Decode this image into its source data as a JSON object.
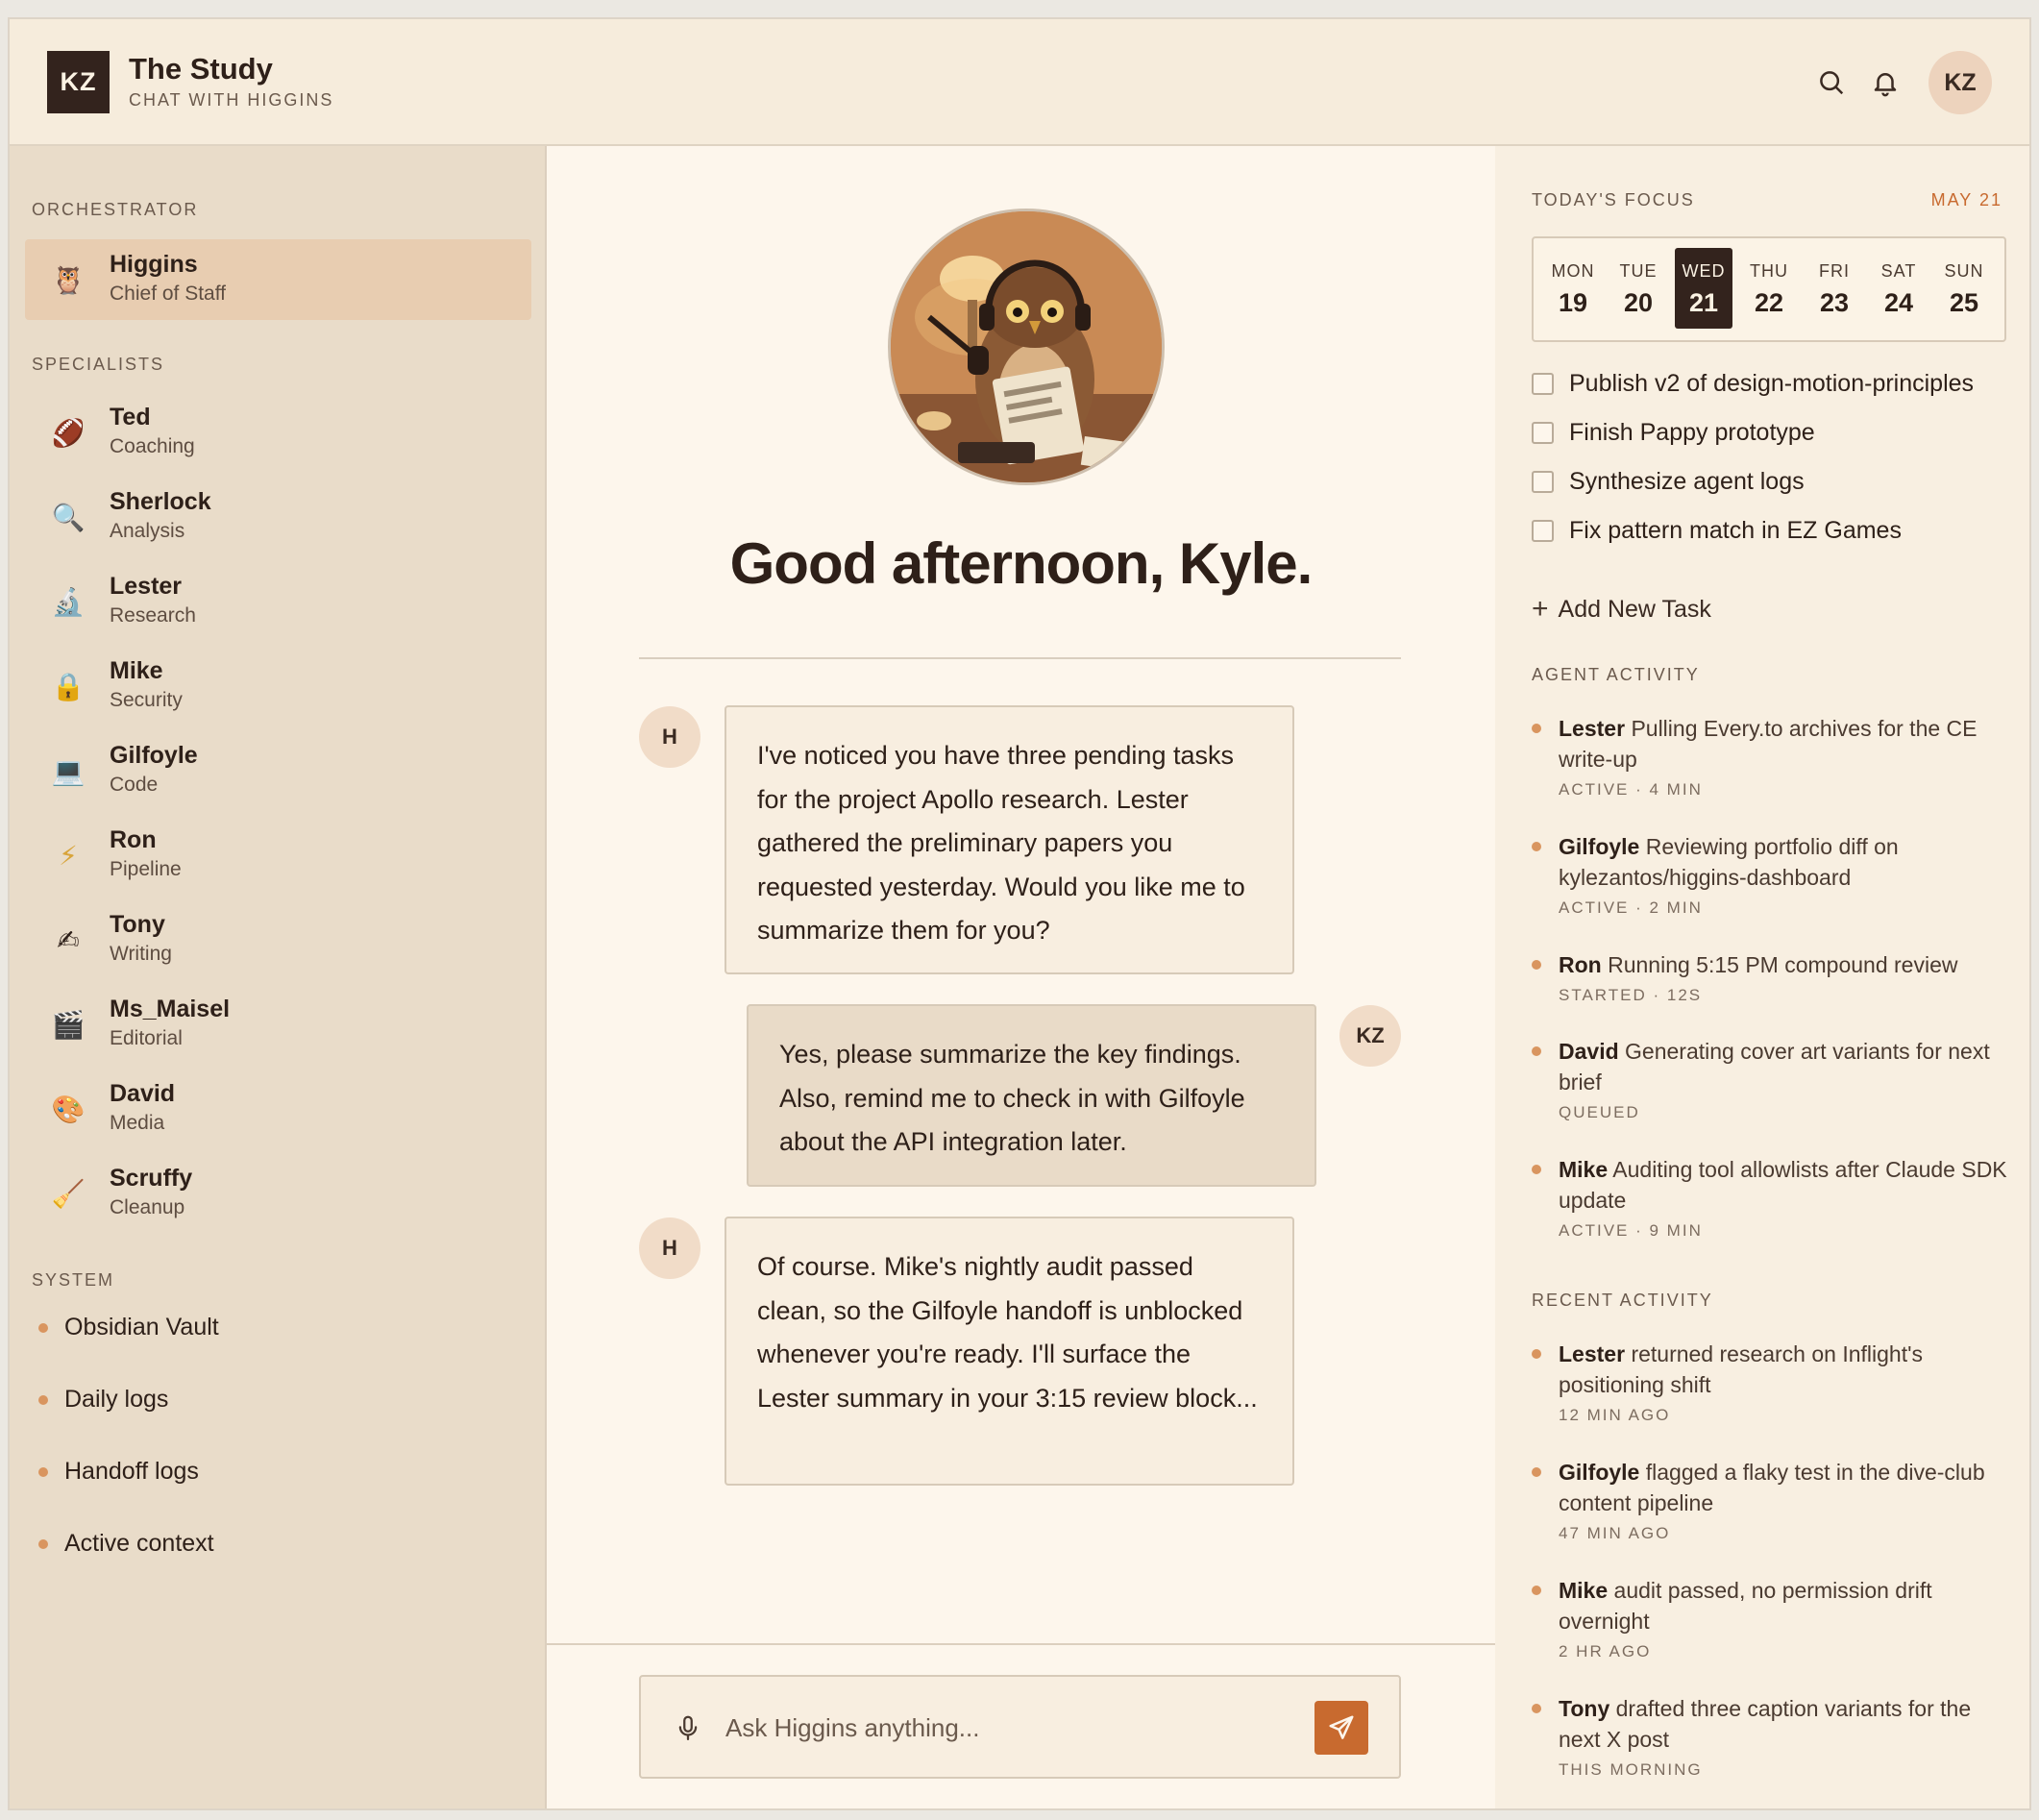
{
  "header": {
    "logo_initials": "KZ",
    "title": "The Study",
    "subtitle": "CHAT WITH HIGGINS",
    "user_initials": "KZ"
  },
  "sidebar": {
    "orchestrator_label": "ORCHESTRATOR",
    "orchestrator": {
      "name": "Higgins",
      "role": "Chief of Staff",
      "icon": "🦉"
    },
    "specialists_label": "SPECIALISTS",
    "specialists": [
      {
        "name": "Ted",
        "role": "Coaching",
        "icon": "🏈"
      },
      {
        "name": "Sherlock",
        "role": "Analysis",
        "icon": "🔍"
      },
      {
        "name": "Lester",
        "role": "Research",
        "icon": "🔬"
      },
      {
        "name": "Mike",
        "role": "Security",
        "icon": "🔒"
      },
      {
        "name": "Gilfoyle",
        "role": "Code",
        "icon": "💻"
      },
      {
        "name": "Ron",
        "role": "Pipeline",
        "icon": "⚡"
      },
      {
        "name": "Tony",
        "role": "Writing",
        "icon": "✍"
      },
      {
        "name": "Ms_Maisel",
        "role": "Editorial",
        "icon": "🎬"
      },
      {
        "name": "David",
        "role": "Media",
        "icon": "🎨"
      },
      {
        "name": "Scruffy",
        "role": "Cleanup",
        "icon": "🧹"
      }
    ],
    "system_label": "SYSTEM",
    "system": [
      "Obsidian Vault",
      "Daily logs",
      "Handoff logs",
      "Active context"
    ]
  },
  "chat": {
    "greeting": "Good afternoon, Kyle.",
    "messages": [
      {
        "from": "H",
        "text": "I've noticed you have three pending tasks for the project Apollo research. Lester gathered the preliminary papers you requested yesterday. Would you like me to summarize them for you?"
      },
      {
        "from": "KZ",
        "text": "Yes, please summarize the key findings. Also, remind me to check in with Gilfoyle about the API integration later."
      },
      {
        "from": "H",
        "text": "Of course. Mike's nightly audit passed clean, so the Gilfoyle handoff is unblocked whenever you're ready. I'll surface the Lester summary in your 3:15 review block..."
      }
    ],
    "input_placeholder": "Ask Higgins anything..."
  },
  "focus": {
    "label": "TODAY'S FOCUS",
    "date": "MAY 21",
    "week": [
      {
        "day": "MON",
        "date": "19"
      },
      {
        "day": "TUE",
        "date": "20"
      },
      {
        "day": "WED",
        "date": "21",
        "selected": true
      },
      {
        "day": "THU",
        "date": "22"
      },
      {
        "day": "FRI",
        "date": "23"
      },
      {
        "day": "SAT",
        "date": "24"
      },
      {
        "day": "SUN",
        "date": "25"
      }
    ],
    "tasks": [
      "Publish v2 of design-motion-principles",
      "Finish Pappy prototype",
      "Synthesize agent logs",
      "Fix pattern match in EZ Games"
    ],
    "add_task_label": "Add New Task"
  },
  "agent_activity": {
    "label": "AGENT ACTIVITY",
    "items": [
      {
        "agent": "Lester",
        "text": "Pulling Every.to archives for the CE write-up",
        "meta": "ACTIVE · 4 MIN"
      },
      {
        "agent": "Gilfoyle",
        "text": "Reviewing portfolio diff on kylezantos/higgins-dashboard",
        "meta": "ACTIVE · 2 MIN"
      },
      {
        "agent": "Ron",
        "text": "Running 5:15 PM compound review",
        "meta": "STARTED · 12S"
      },
      {
        "agent": "David",
        "text": "Generating cover art variants for next brief",
        "meta": "QUEUED"
      },
      {
        "agent": "Mike",
        "text": "Auditing tool allowlists after Claude SDK update",
        "meta": "ACTIVE · 9 MIN"
      }
    ]
  },
  "recent_activity": {
    "label": "RECENT ACTIVITY",
    "items": [
      {
        "agent": "Lester",
        "text": "returned research on Inflight's positioning shift",
        "meta": "12 MIN AGO"
      },
      {
        "agent": "Gilfoyle",
        "text": "flagged a flaky test in the dive-club content pipeline",
        "meta": "47 MIN AGO"
      },
      {
        "agent": "Mike",
        "text": "audit passed, no permission drift overnight",
        "meta": "2 HR AGO"
      },
      {
        "agent": "Tony",
        "text": "drafted three caption variants for the next X post",
        "meta": "THIS MORNING"
      }
    ]
  }
}
